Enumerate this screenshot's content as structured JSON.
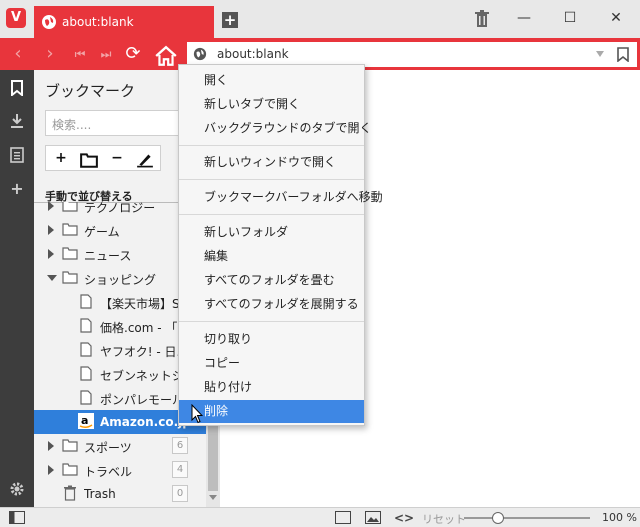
{
  "tab": {
    "title": "about:blank"
  },
  "address": {
    "url": "about:blank"
  },
  "panel": {
    "title": "ブックマーク",
    "search_placeholder": "検索....",
    "sort_label": "手動で並び替える"
  },
  "tree": [
    {
      "label": "テクノロジー",
      "type": "folder"
    },
    {
      "label": "ゲーム",
      "type": "folder"
    },
    {
      "label": "ニュース",
      "type": "folder"
    },
    {
      "label": "ショッピング",
      "type": "folder-open"
    },
    {
      "label": "【楽天市場】Sh",
      "type": "page"
    },
    {
      "label": "価格.com - 「...",
      "type": "page"
    },
    {
      "label": "ヤフオク! - 日...",
      "type": "page"
    },
    {
      "label": "セブンネットショ",
      "type": "page"
    },
    {
      "label": "ポンパレモール:",
      "type": "page"
    },
    {
      "label": "Amazon.co.jp:",
      "type": "amazon"
    },
    {
      "label": "スポーツ",
      "type": "folder",
      "count": "6"
    },
    {
      "label": "トラベル",
      "type": "folder",
      "count": "4"
    },
    {
      "label": "Trash",
      "type": "trash",
      "count": "0"
    }
  ],
  "menu": [
    "開く",
    "新しいタブで開く",
    "バックグラウンドのタブで開く",
    "新しいウィンドウで開く",
    "ブックマークバーフォルダへ移動",
    "新しいフォルダ",
    "編集",
    "すべてのフォルダを畳む",
    "すべてのフォルダを展開する",
    "切り取り",
    "コピー",
    "貼り付け",
    "削除"
  ],
  "status": {
    "reset_label": "リセット",
    "zoom": "100 %"
  },
  "colors": {
    "accent": "#e8353c",
    "selection": "#2f7fdb",
    "menu_highlight": "#3e87e4"
  }
}
